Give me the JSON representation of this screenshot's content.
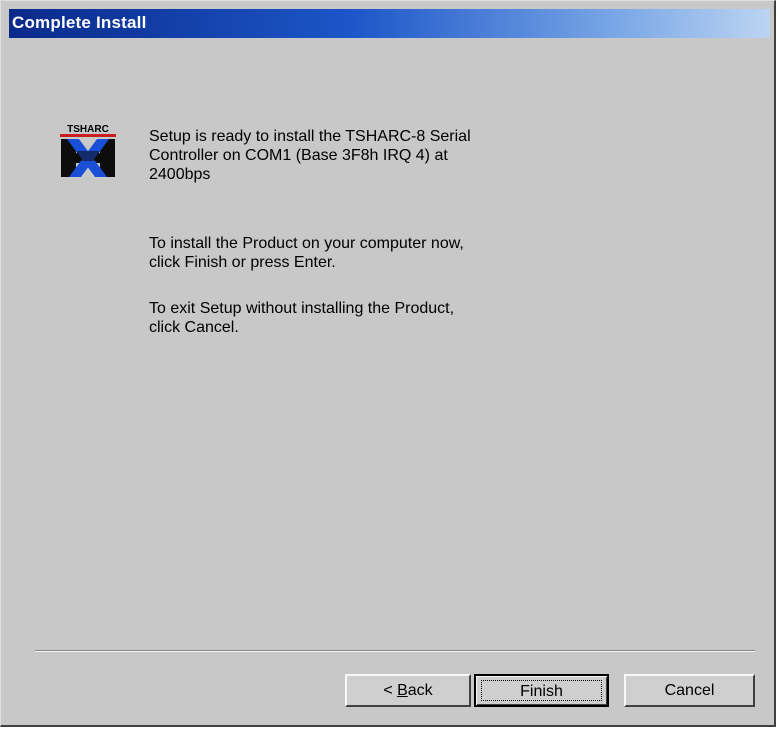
{
  "window": {
    "title": "Complete Install"
  },
  "logo": {
    "icon": "tsharc-logo-icon",
    "text": "TSHARC"
  },
  "message": {
    "paragraph1": [
      "Setup is ready to install the TSHARC-8 Serial",
      "Controller on COM1 (Base  3F8h IRQ  4) at",
      "2400bps"
    ],
    "paragraph2": [
      "To install the Product on your computer now,",
      "click Finish or press Enter."
    ],
    "paragraph3": [
      "To exit Setup without installing the Product,",
      "click Cancel."
    ]
  },
  "buttons": {
    "back_prefix": "< ",
    "back_accel": "B",
    "back_rest": "ack",
    "finish": "Finish",
    "cancel": "Cancel"
  },
  "colors": {
    "face": "#c8c8c8",
    "title_start": "#0a2a8a",
    "title_end": "#bcd4f2"
  }
}
